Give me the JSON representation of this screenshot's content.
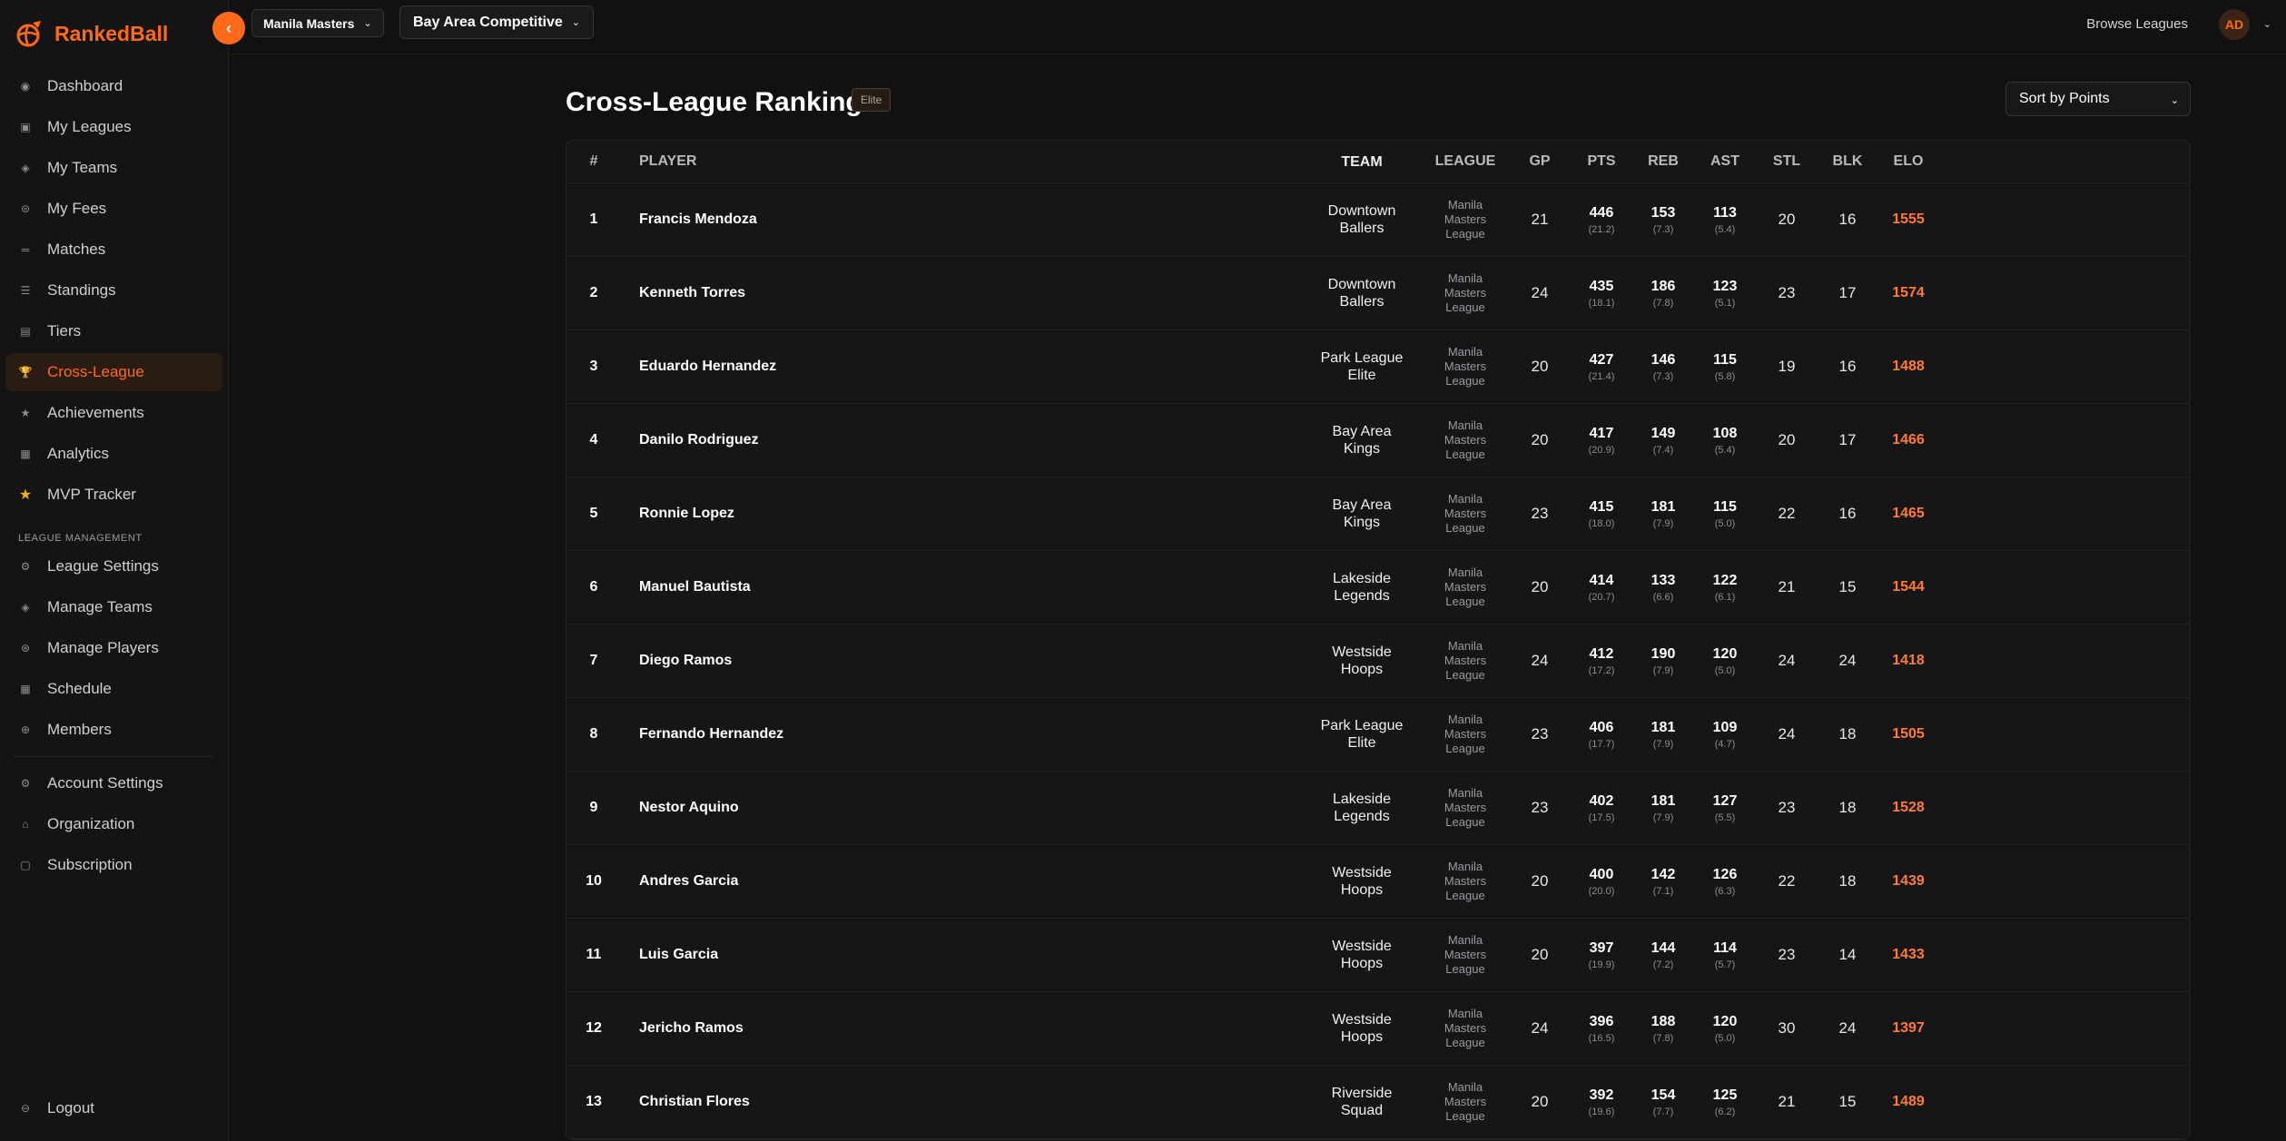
{
  "brand": {
    "name": "RankedBall"
  },
  "nav": [
    {
      "label": "Dashboard",
      "icon": "dashboard-icon",
      "glyph": "◉"
    },
    {
      "label": "My Leagues",
      "icon": "leagues-icon",
      "glyph": "▣"
    },
    {
      "label": "My Teams",
      "icon": "teams-icon",
      "glyph": "◈"
    },
    {
      "label": "My Fees",
      "icon": "fees-icon",
      "glyph": "⊜"
    },
    {
      "label": "Matches",
      "icon": "matches-icon",
      "glyph": "═"
    },
    {
      "label": "Standings",
      "icon": "standings-icon",
      "glyph": "☰"
    },
    {
      "label": "Tiers",
      "icon": "tiers-icon",
      "glyph": "▤"
    },
    {
      "label": "Cross-League",
      "icon": "trophy-icon",
      "glyph": "🏆",
      "active": true
    },
    {
      "label": "Achievements",
      "icon": "star-icon",
      "glyph": "★"
    },
    {
      "label": "Analytics",
      "icon": "analytics-icon",
      "glyph": "▦"
    },
    {
      "label": "MVP Tracker",
      "icon": "mvp-star-icon",
      "glyph": "★"
    }
  ],
  "management": {
    "section_label": "LEAGUE MANAGEMENT",
    "items": [
      {
        "label": "League Settings",
        "icon": "settings-icon",
        "glyph": "⚙"
      },
      {
        "label": "Manage Teams",
        "icon": "manage-teams-icon",
        "glyph": "◈"
      },
      {
        "label": "Manage Players",
        "icon": "players-icon",
        "glyph": "⊛"
      },
      {
        "label": "Schedule",
        "icon": "schedule-icon",
        "glyph": "▦"
      },
      {
        "label": "Members",
        "icon": "members-icon",
        "glyph": "⊕"
      }
    ]
  },
  "account": [
    {
      "label": "Account Settings",
      "icon": "account-settings-icon",
      "glyph": "⚙"
    },
    {
      "label": "Organization",
      "icon": "organization-icon",
      "glyph": "⌂"
    },
    {
      "label": "Subscription",
      "icon": "subscription-icon",
      "glyph": "▢"
    }
  ],
  "logout": {
    "label": "Logout",
    "glyph": "⊖"
  },
  "topbar": {
    "org": "Manila Masters",
    "league": "Bay Area Competitive",
    "browse": "Browse Leagues",
    "avatar": "AD"
  },
  "page": {
    "title": "Cross-League Ranking",
    "tier": "Elite",
    "sort": "Sort by Points"
  },
  "columns": {
    "rank": "#",
    "player": "PLAYER",
    "team": "TEAM",
    "league": "LEAGUE",
    "gp": "GP",
    "pts": "PTS",
    "reb": "REB",
    "ast": "AST",
    "stl": "STL",
    "blk": "BLK",
    "elo": "ELO"
  },
  "rows": [
    {
      "rank": "1",
      "player": "Francis Mendoza",
      "team": [
        "Downtown",
        "Ballers"
      ],
      "league": [
        "Manila",
        "Masters",
        "League"
      ],
      "gp": "21",
      "pts": "446",
      "pts_avg": "(21.2)",
      "reb": "153",
      "reb_avg": "(7.3)",
      "ast": "113",
      "ast_avg": "(5.4)",
      "stl": "20",
      "blk": "16",
      "elo": "1555"
    },
    {
      "rank": "2",
      "player": "Kenneth Torres",
      "team": [
        "Downtown",
        "Ballers"
      ],
      "league": [
        "Manila",
        "Masters",
        "League"
      ],
      "gp": "24",
      "pts": "435",
      "pts_avg": "(18.1)",
      "reb": "186",
      "reb_avg": "(7.8)",
      "ast": "123",
      "ast_avg": "(5.1)",
      "stl": "23",
      "blk": "17",
      "elo": "1574"
    },
    {
      "rank": "3",
      "player": "Eduardo Hernandez",
      "team": [
        "Park League",
        "Elite"
      ],
      "league": [
        "Manila",
        "Masters",
        "League"
      ],
      "gp": "20",
      "pts": "427",
      "pts_avg": "(21.4)",
      "reb": "146",
      "reb_avg": "(7.3)",
      "ast": "115",
      "ast_avg": "(5.8)",
      "stl": "19",
      "blk": "16",
      "elo": "1488"
    },
    {
      "rank": "4",
      "player": "Danilo Rodriguez",
      "team": [
        "Bay Area",
        "Kings"
      ],
      "league": [
        "Manila",
        "Masters",
        "League"
      ],
      "gp": "20",
      "pts": "417",
      "pts_avg": "(20.9)",
      "reb": "149",
      "reb_avg": "(7.4)",
      "ast": "108",
      "ast_avg": "(5.4)",
      "stl": "20",
      "blk": "17",
      "elo": "1466"
    },
    {
      "rank": "5",
      "player": "Ronnie Lopez",
      "team": [
        "Bay Area",
        "Kings"
      ],
      "league": [
        "Manila",
        "Masters",
        "League"
      ],
      "gp": "23",
      "pts": "415",
      "pts_avg": "(18.0)",
      "reb": "181",
      "reb_avg": "(7.9)",
      "ast": "115",
      "ast_avg": "(5.0)",
      "stl": "22",
      "blk": "16",
      "elo": "1465"
    },
    {
      "rank": "6",
      "player": "Manuel Bautista",
      "team": [
        "Lakeside",
        "Legends"
      ],
      "league": [
        "Manila",
        "Masters",
        "League"
      ],
      "gp": "20",
      "pts": "414",
      "pts_avg": "(20.7)",
      "reb": "133",
      "reb_avg": "(6.6)",
      "ast": "122",
      "ast_avg": "(6.1)",
      "stl": "21",
      "blk": "15",
      "elo": "1544"
    },
    {
      "rank": "7",
      "player": "Diego Ramos",
      "team": [
        "Westside",
        "Hoops"
      ],
      "league": [
        "Manila",
        "Masters",
        "League"
      ],
      "gp": "24",
      "pts": "412",
      "pts_avg": "(17.2)",
      "reb": "190",
      "reb_avg": "(7.9)",
      "ast": "120",
      "ast_avg": "(5.0)",
      "stl": "24",
      "blk": "24",
      "elo": "1418"
    },
    {
      "rank": "8",
      "player": "Fernando Hernandez",
      "team": [
        "Park League",
        "Elite"
      ],
      "league": [
        "Manila",
        "Masters",
        "League"
      ],
      "gp": "23",
      "pts": "406",
      "pts_avg": "(17.7)",
      "reb": "181",
      "reb_avg": "(7.9)",
      "ast": "109",
      "ast_avg": "(4.7)",
      "stl": "24",
      "blk": "18",
      "elo": "1505"
    },
    {
      "rank": "9",
      "player": "Nestor Aquino",
      "team": [
        "Lakeside",
        "Legends"
      ],
      "league": [
        "Manila",
        "Masters",
        "League"
      ],
      "gp": "23",
      "pts": "402",
      "pts_avg": "(17.5)",
      "reb": "181",
      "reb_avg": "(7.9)",
      "ast": "127",
      "ast_avg": "(5.5)",
      "stl": "23",
      "blk": "18",
      "elo": "1528"
    },
    {
      "rank": "10",
      "player": "Andres Garcia",
      "team": [
        "Westside",
        "Hoops"
      ],
      "league": [
        "Manila",
        "Masters",
        "League"
      ],
      "gp": "20",
      "pts": "400",
      "pts_avg": "(20.0)",
      "reb": "142",
      "reb_avg": "(7.1)",
      "ast": "126",
      "ast_avg": "(6.3)",
      "stl": "22",
      "blk": "18",
      "elo": "1439"
    },
    {
      "rank": "11",
      "player": "Luis Garcia",
      "team": [
        "Westside",
        "Hoops"
      ],
      "league": [
        "Manila",
        "Masters",
        "League"
      ],
      "gp": "20",
      "pts": "397",
      "pts_avg": "(19.9)",
      "reb": "144",
      "reb_avg": "(7.2)",
      "ast": "114",
      "ast_avg": "(5.7)",
      "stl": "23",
      "blk": "14",
      "elo": "1433"
    },
    {
      "rank": "12",
      "player": "Jericho Ramos",
      "team": [
        "Westside",
        "Hoops"
      ],
      "league": [
        "Manila",
        "Masters",
        "League"
      ],
      "gp": "24",
      "pts": "396",
      "pts_avg": "(16.5)",
      "reb": "188",
      "reb_avg": "(7.8)",
      "ast": "120",
      "ast_avg": "(5.0)",
      "stl": "30",
      "blk": "24",
      "elo": "1397"
    },
    {
      "rank": "13",
      "player": "Christian Flores",
      "team": [
        "Riverside",
        "Squad"
      ],
      "league": [
        "Manila",
        "Masters",
        "League"
      ],
      "gp": "20",
      "pts": "392",
      "pts_avg": "(19.6)",
      "reb": "154",
      "reb_avg": "(7.7)",
      "ast": "125",
      "ast_avg": "(6.2)",
      "stl": "21",
      "blk": "15",
      "elo": "1489"
    }
  ]
}
